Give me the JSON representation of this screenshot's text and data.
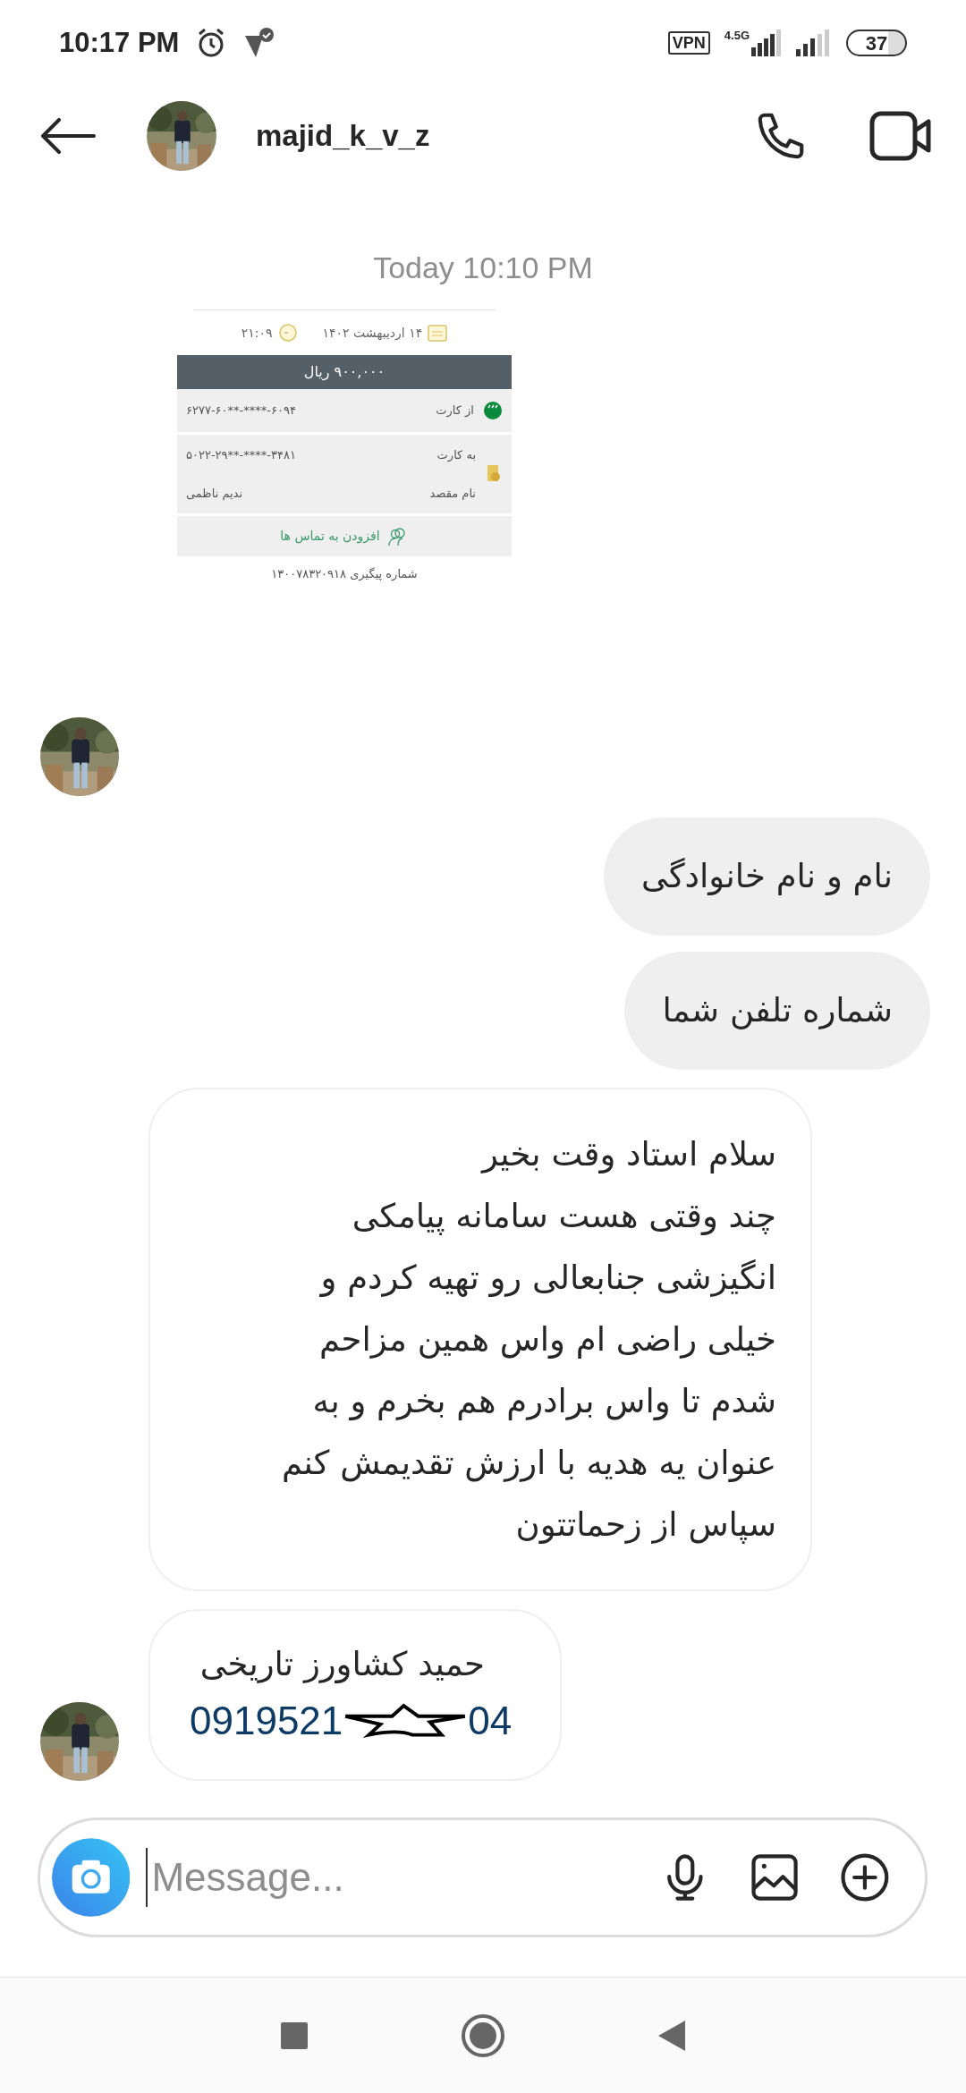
{
  "status_bar": {
    "time": "10:17 PM",
    "vpn": "VPN",
    "network": "4.5G",
    "battery": "37"
  },
  "header": {
    "username": "majid_k_v_z"
  },
  "messages": [
    {
      "kind": "timestamp",
      "text": "Today 10:10 PM"
    },
    {
      "kind": "receipt",
      "date": "۱۴ اردیبهشت ۱۴۰۲",
      "time": "۲۱:۰۹",
      "amount": "۹۰۰,۰۰۰ ریال",
      "from_label": "از کارت",
      "from_card": "۶۲۷۷-۶۰**-****-۶۰۹۴",
      "to_label": "به کارت",
      "to_card": "۵۰۲۲-۲۹**-****-۳۴۸۱",
      "dest_label": "نام مقصد",
      "dest_name": "ندیم ناظمی",
      "add_contact": "افزودن به تماس ها",
      "tracking": "شماره پیگیری ۱۳۰۰۷۸۳۲۰۹۱۸"
    },
    {
      "kind": "avatar"
    },
    {
      "kind": "sent",
      "text": "نام و نام خانوادگی"
    },
    {
      "kind": "sent",
      "text": "شماره تلفن شما"
    },
    {
      "kind": "received",
      "text": "سلام استاد وقت بخیر\nچند وقتی هست سامانه پیامکی\nانگیزشی جنابعالی رو تهیه کردم و\nخیلی راضی ام واس همین مزاحم\nشدم تا واس برادرم هم بخرم و به\nعنوان یه هدیه با ارزش تقدیمش کنم\nسپاس از زحماتتون"
    },
    {
      "kind": "contact",
      "name": "حمید کشاورز تاریخی",
      "phone_start": "0919521",
      "phone_end": "04"
    }
  ],
  "composer": {
    "placeholder": "Message..."
  }
}
